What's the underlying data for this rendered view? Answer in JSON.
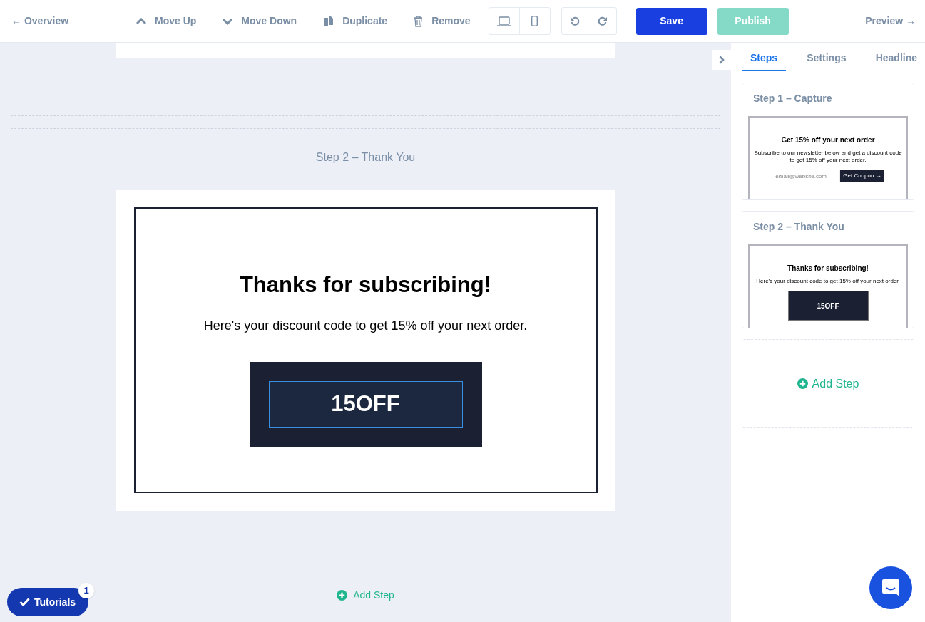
{
  "topbar": {
    "back_link": "← Overview",
    "actions": [
      {
        "kind": "up",
        "label": "Move Up"
      },
      {
        "kind": "down",
        "label": "Move Down"
      },
      {
        "kind": "duplicate",
        "label": "Duplicate"
      },
      {
        "kind": "remove",
        "label": "Remove"
      }
    ],
    "save": "Save",
    "publish": {
      "label": "Publish",
      "disabled": true
    },
    "preview_link": "Preview →"
  },
  "canvas": {
    "step_title": "Step 2 – Thank You",
    "heading": "Thanks for subscribing!",
    "text": "Here's your discount code to get 15% off your next order.",
    "code": "15OFF",
    "add_step": "Add Step"
  },
  "panel": {
    "tabs": [
      {
        "label": "Steps",
        "selected": true
      },
      {
        "label": "Settings",
        "selected": false
      },
      {
        "label": "Headline",
        "selected": false
      }
    ],
    "steps": [
      {
        "kind": "capture",
        "title": "Step 1 – Capture",
        "heading": "Get 15% off your next order",
        "text": "Subscribe to our newsletter below and get a discount code to get 15% off your next order.",
        "placeholder": "email@website.com",
        "button": "Get Coupon →"
      },
      {
        "kind": "thank_you",
        "title": "Step 2 – Thank You",
        "heading": "Thanks for subscribing!",
        "text": "Here's your discount code to get 15% off your next order.",
        "code": "15OFF"
      }
    ],
    "add_step": "Add Step"
  },
  "tutorials": {
    "label": "Tutorials",
    "badge": "1"
  }
}
